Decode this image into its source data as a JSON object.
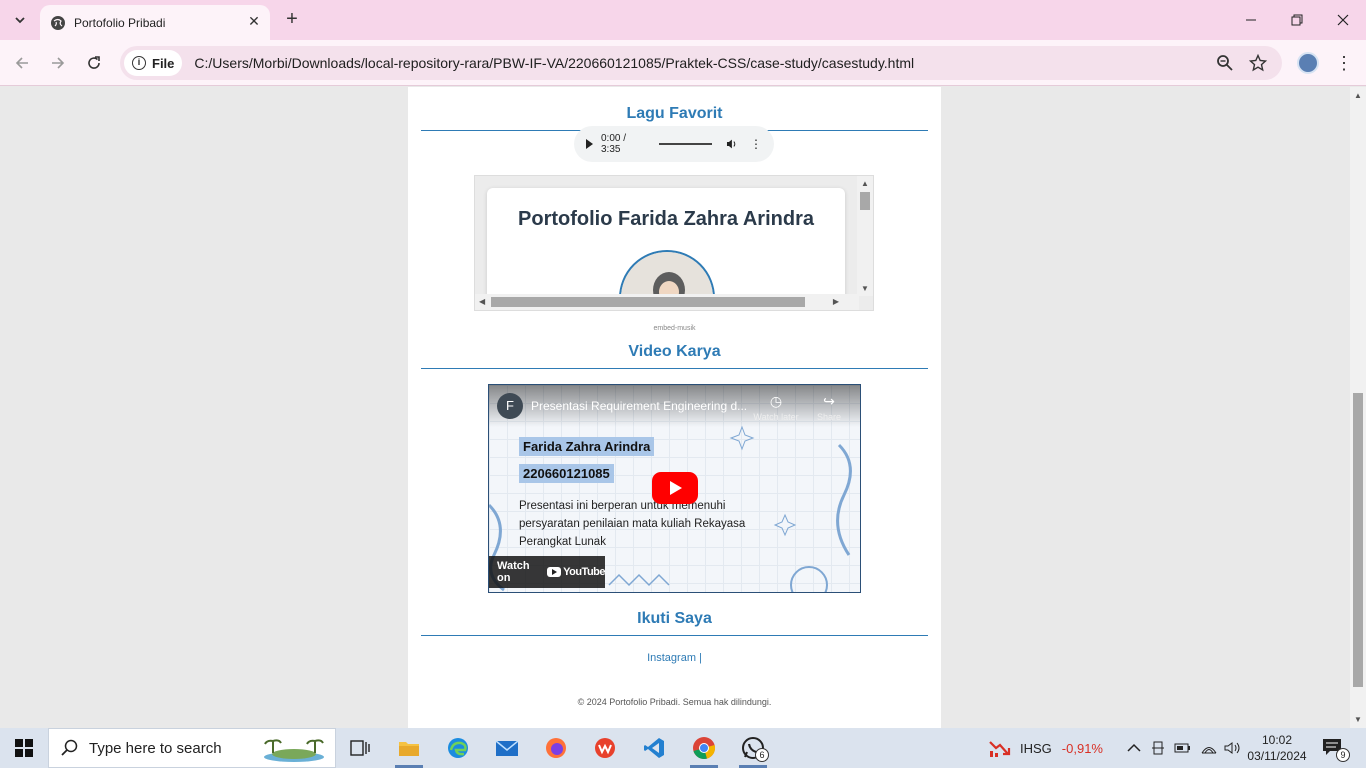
{
  "browser": {
    "tab_title": "Portofolio Pribadi",
    "site_chip": "File",
    "url": "C:/Users/Morbi/Downloads/local-repository-rara/PBW-IF-VA/220660121085/Praktek-CSS/case-study/casestudy.html"
  },
  "page": {
    "music_section_title": "Lagu Favorit",
    "audio_time": "0:00 / 3:35",
    "embed_title": "Portofolio Farida Zahra Arindra",
    "embed_caption": "embed-musik",
    "video_section_title": "Video Karya",
    "video": {
      "channel_initial": "F",
      "title": "Presentasi Requirement Engineering d...",
      "watch_later": "Watch later",
      "share": "Share",
      "name_highlight": "Farida Zahra Arindra",
      "id_highlight": "220660121085",
      "description": "Presentasi ini berperan untuk memenuhi persyaratan penilaian mata kuliah Rekayasa Perangkat Lunak",
      "watch_on": "Watch on",
      "youtube": "YouTube"
    },
    "follow_section_title": "Ikuti Saya",
    "instagram_link": "Instagram |",
    "footer": "© 2024 Portofolio Pribadi. Semua hak dilindungi."
  },
  "taskbar": {
    "search_placeholder": "Type here to search",
    "whatsapp_badge": "6",
    "stock_name": "IHSG",
    "stock_change": "-0,91%",
    "time": "10:02",
    "date": "03/11/2024",
    "notification_count": "9"
  },
  "colors": {
    "accent": "#2e7bb5",
    "tabstrip": "#f7d6ea",
    "stock_negative": "#d93025"
  }
}
